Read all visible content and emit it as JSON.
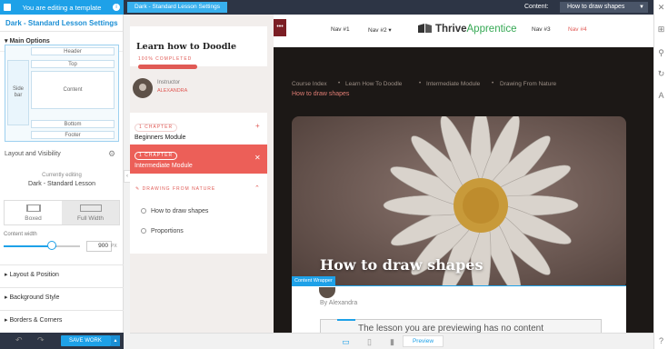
{
  "topbar": {
    "editing_label": "You are editing a template",
    "breadcrumb": "Dark - Standard Lesson Settings",
    "content_label": "Content:",
    "content_value": "How to draw shapes"
  },
  "panel": {
    "title": "Dark - Standard Lesson Settings",
    "main_options": "Main Options",
    "layout_boxes": {
      "header": "Header",
      "top": "Top",
      "sidebar": "Side\nbar",
      "content": "Content",
      "bottom": "Bottom",
      "footer": "Footer"
    },
    "layout_visibility": "Layout and Visibility",
    "currently_editing": "Currently editing",
    "template_name": "Dark - Standard Lesson",
    "boxed": "Boxed",
    "full_width": "Full Width",
    "content_width_label": "Content width",
    "content_width_value": "900",
    "content_width_unit": "PX",
    "content_width_fraction": 0.62,
    "sections": [
      "Layout & Position",
      "Background Style",
      "Borders & Corners"
    ],
    "save_label": "SAVE WORK"
  },
  "sidebar": {
    "lesson_title": "Learn how to Doodle",
    "progress_label": "100% COMPLETED",
    "progress": 1.0,
    "instructor_label": "Instructor",
    "instructor_name": "ALEXANDRA",
    "chapters": [
      {
        "badge": "1 CHAPTER",
        "name": "Beginners Module",
        "active": false
      },
      {
        "badge": "1 CHAPTER",
        "name": "Intermediate Module",
        "active": true
      }
    ],
    "module_name": "DRAWING FROM NATURE",
    "lessons": [
      "How to draw shapes",
      "Proportions"
    ]
  },
  "preview": {
    "nav": [
      "Nav #1",
      "Nav #2",
      "Nav #3",
      "Nav #4"
    ],
    "logo_thrive": "Thrive",
    "logo_apprentice": "Apprentice",
    "breadcrumbs": [
      "Course Index",
      "Learn How To Doodle",
      "Intermediate Module",
      "Drawing From Nature"
    ],
    "breadcrumb_current": "How to draw shapes",
    "hero_title": "How to draw shapes",
    "content_wrapper_label": "Content Wrapper",
    "byline": "By Alexandra",
    "notice": "The lesson you are previewing has no content"
  },
  "bottom": {
    "preview_label": "Preview"
  },
  "colors": {
    "accent": "#1ea1e8",
    "brand_red": "#ec5f58",
    "dark_bg": "#1c1816"
  }
}
